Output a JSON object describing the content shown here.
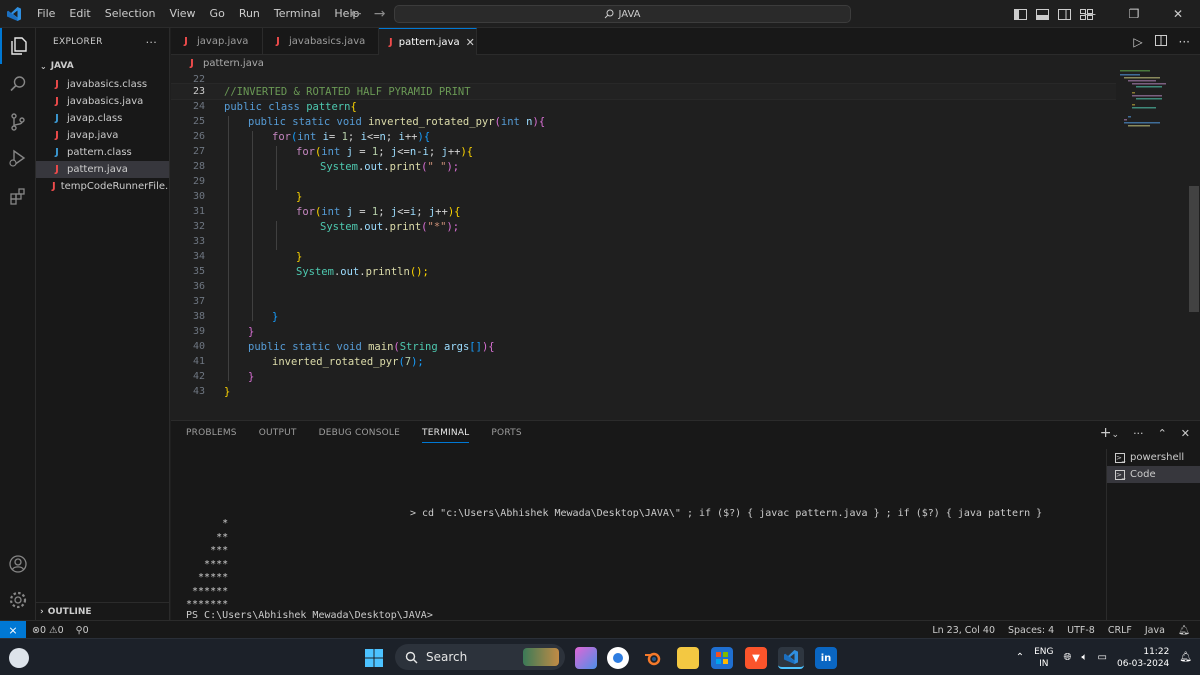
{
  "titlebar": {
    "menu": [
      "File",
      "Edit",
      "Selection",
      "View",
      "Go",
      "Run",
      "Terminal",
      "Help"
    ],
    "command_center": "JAVA"
  },
  "explorer": {
    "title": "EXPLORER",
    "more": "···",
    "folder": "JAVA",
    "files": [
      {
        "name": "javabasics.class",
        "icon": "J",
        "color": "#f14c4c"
      },
      {
        "name": "javabasics.java",
        "icon": "J",
        "color": "#f14c4c"
      },
      {
        "name": "javap.class",
        "icon": "J",
        "color": "#3c9bd6"
      },
      {
        "name": "javap.java",
        "icon": "J",
        "color": "#f14c4c"
      },
      {
        "name": "pattern.class",
        "icon": "J",
        "color": "#3c9bd6"
      },
      {
        "name": "pattern.java",
        "icon": "J",
        "color": "#f14c4c"
      },
      {
        "name": "tempCodeRunnerFile....",
        "icon": "J",
        "color": "#f14c4c"
      }
    ],
    "outline": "OUTLINE"
  },
  "tabs": [
    {
      "label": "javap.java"
    },
    {
      "label": "javabasics.java"
    },
    {
      "label": "pattern.java",
      "close": "✕"
    }
  ],
  "breadcrumb": "pattern.java",
  "editor": {
    "line_numbers": [
      "22",
      "23",
      "24",
      "25",
      "26",
      "27",
      "28",
      "29",
      "30",
      "31",
      "32",
      "33",
      "34",
      "35",
      "36",
      "37",
      "38",
      "39",
      "40",
      "41",
      "42",
      "43"
    ],
    "lines": {
      "l23": "//INVERTED & ROTATED HALF PYRAMID PRINT",
      "l24a": "public class ",
      "l24b": "pattern",
      "l24c": "{",
      "l25a": "public static void ",
      "l25b": "inverted_rotated_pyr",
      "l25c": "(",
      "l25d": "int ",
      "l25e": "n",
      "l25f": "){",
      "l26a": "for",
      "l26b": "(",
      "l26c": "int ",
      "l26d": "i",
      "l26e": "= ",
      "l26f": "1",
      "l26g": "; ",
      "l26h": "i",
      "l26i": "<=",
      "l26j": "n",
      "l26k": "; ",
      "l26l": "i",
      "l26m": "++",
      "l26n": "){",
      "l27a": "for",
      "l27b": "(",
      "l27c": "int ",
      "l27d": "j",
      "l27e": " = ",
      "l27f": "1",
      "l27g": "; ",
      "l27h": "j",
      "l27i": "<=",
      "l27j": "n",
      "l27k": "-",
      "l27l": "i",
      "l27m": "; ",
      "l27n": "j",
      "l27o": "++",
      "l27p": "){",
      "l28a": "System",
      "l28b": ".",
      "l28c": "out",
      "l28d": ".",
      "l28e": "print",
      "l28f": "(",
      "l28g": "\" \"",
      "l28h": ");",
      "l30": "}",
      "l31a": "for",
      "l31b": "(",
      "l31c": "int ",
      "l31d": "j",
      "l31e": " = ",
      "l31f": "1",
      "l31g": "; ",
      "l31h": "j",
      "l31i": "<=",
      "l31j": "i",
      "l31k": "; ",
      "l31l": "j",
      "l31m": "++",
      "l31n": "){",
      "l32a": "System",
      "l32b": ".",
      "l32c": "out",
      "l32d": ".",
      "l32e": "print",
      "l32f": "(",
      "l32g": "\"*\"",
      "l32h": ");",
      "l34": "}",
      "l35a": "System",
      "l35b": ".",
      "l35c": "out",
      "l35d": ".",
      "l35e": "println",
      "l35f": "();",
      "l38": "}",
      "l39": "}",
      "l40a": "public static void ",
      "l40b": "main",
      "l40c": "(",
      "l40d": "String ",
      "l40e": "args",
      "l40f": "[]",
      "l40g": "){",
      "l41a": "inverted_rotated_pyr",
      "l41b": "(",
      "l41c": "7",
      "l41d": ");",
      "l42": "}",
      "l43": "}"
    }
  },
  "panel": {
    "tabs": [
      "PROBLEMS",
      "OUTPUT",
      "DEBUG CONSOLE",
      "TERMINAL",
      "PORTS"
    ],
    "actions": {
      "add": "+",
      "dropdown": "⌄",
      "more": "···",
      "maximize": "⌃",
      "close": "✕"
    },
    "terminal": {
      "command": "> cd \"c:\\Users\\Abhishek Mewada\\Desktop\\JAVA\\\" ; if ($?) { javac pattern.java } ; if ($?) { java pattern }",
      "output": [
        "      *",
        "     **",
        "    ***",
        "   ****",
        "  *****",
        " ******",
        "*******"
      ],
      "prompt": "PS C:\\Users\\Abhishek Mewada\\Desktop\\JAVA>"
    },
    "terminal_list": [
      "powershell",
      "Code"
    ]
  },
  "statusbar": {
    "problems": "0",
    "warnings": "0",
    "ports": "0",
    "position": "Ln 23, Col 40",
    "spaces": "Spaces: 4",
    "encoding": "UTF-8",
    "eol": "CRLF",
    "language": "Java"
  },
  "taskbar": {
    "search": "Search",
    "lang_top": "ENG",
    "lang_bottom": "IN",
    "time": "11:22",
    "date": "06-03-2024"
  }
}
